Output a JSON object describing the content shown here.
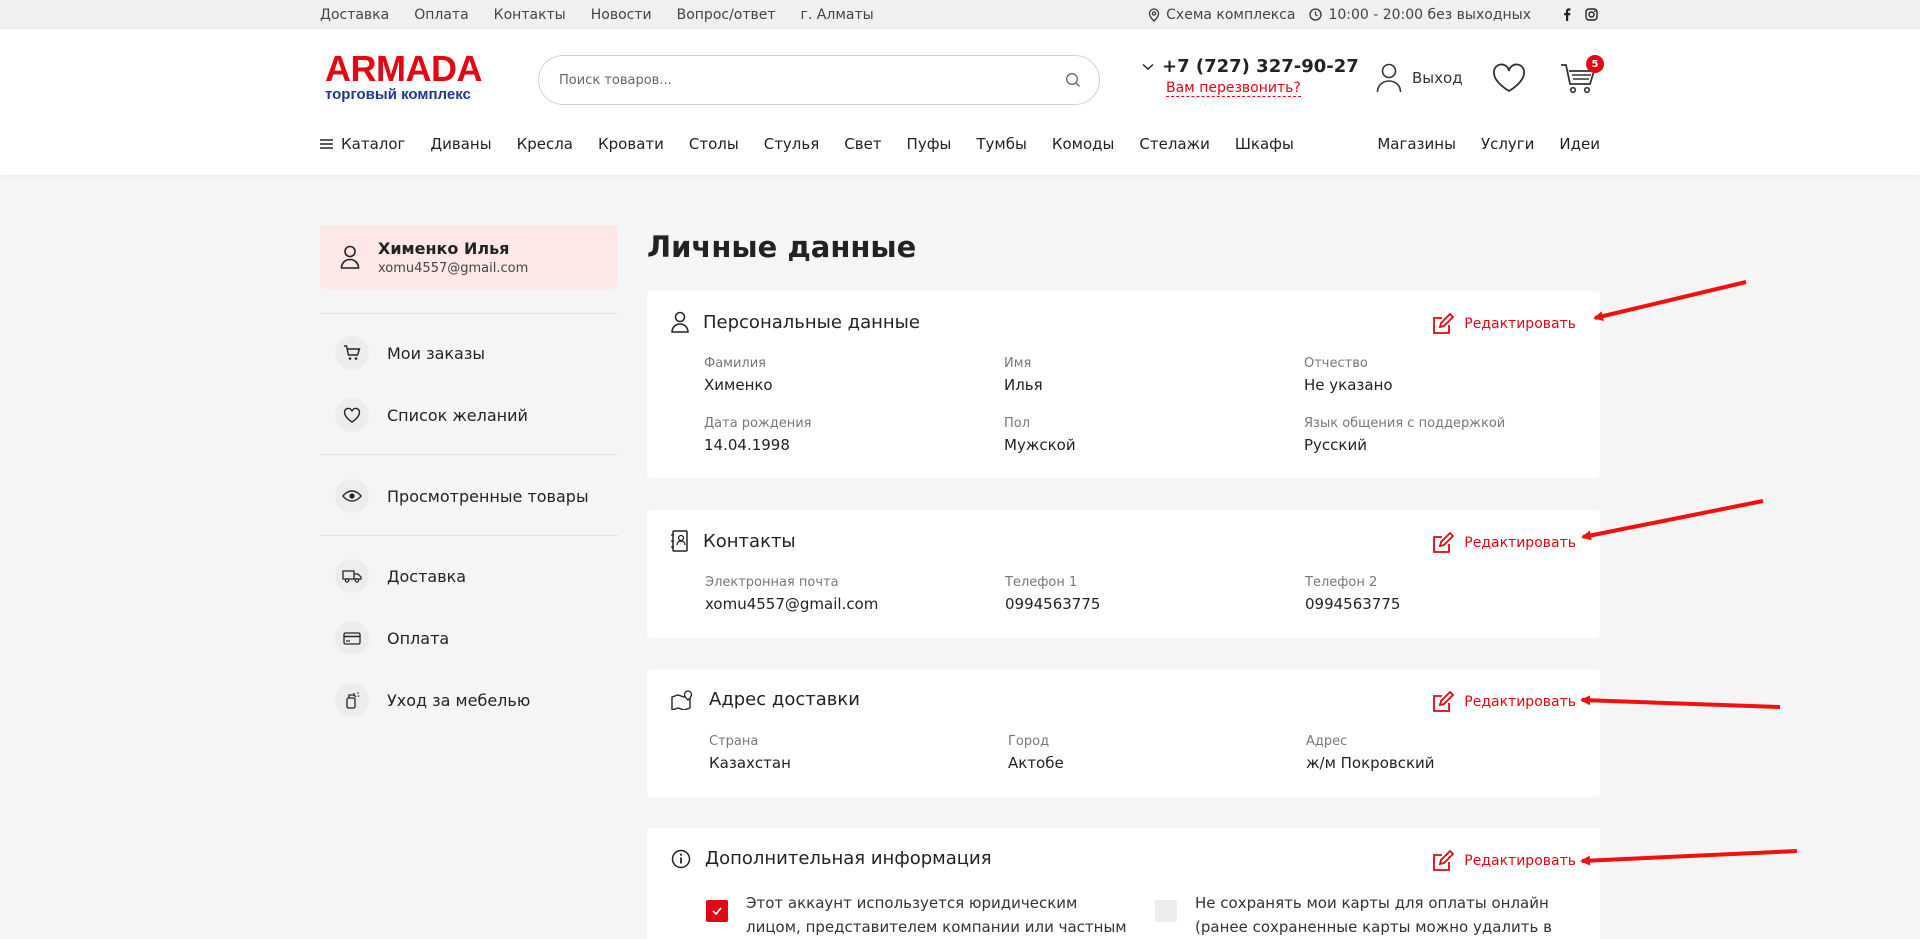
{
  "topbar": {
    "links": [
      "Доставка",
      "Оплата",
      "Контакты",
      "Новости",
      "Вопрос/ответ",
      "г. Алматы"
    ],
    "scheme": "Схема комплекса",
    "hours": "10:00 - 20:00 без выходных"
  },
  "header": {
    "logo_brand": "ARMADA",
    "logo_sub": "торговый комплекс",
    "search_placeholder": "Поиск товаров...",
    "phone": "+7 (727) 327-90-27",
    "callback": "Вам перезвонить?",
    "account_label": "Выход",
    "cart_count": "5"
  },
  "nav": {
    "catalog": "Каталог",
    "items": [
      "Диваны",
      "Кресла",
      "Кровати",
      "Столы",
      "Стулья",
      "Свет",
      "Пуфы",
      "Тумбы",
      "Комоды",
      "Стелажи",
      "Шкафы"
    ],
    "right": [
      "Магазины",
      "Услуги",
      "Идеи"
    ]
  },
  "sidebar": {
    "user_name": "Хименко Илья",
    "user_email": "xomu4557@gmail.com",
    "items": [
      "Мои заказы",
      "Список желаний",
      "Просмотренные товары",
      "Доставка",
      "Оплата",
      "Уход за мебелью"
    ]
  },
  "main": {
    "title": "Личные данные",
    "edit_label": "Редактировать",
    "personal": {
      "heading": "Персональные данные",
      "fields": [
        {
          "label": "Фамилия",
          "value": "Хименко"
        },
        {
          "label": "Имя",
          "value": "Илья"
        },
        {
          "label": "Отчество",
          "value": "Не указано"
        },
        {
          "label": "Дата рождения",
          "value": "14.04.1998"
        },
        {
          "label": "Пол",
          "value": "Мужской"
        },
        {
          "label": "Язык общения с поддержкой",
          "value": "Русский"
        }
      ]
    },
    "contacts": {
      "heading": "Контакты",
      "fields": [
        {
          "label": "Электронная почта",
          "value": "xomu4557@gmail.com"
        },
        {
          "label": "Телефон 1",
          "value": "0994563775"
        },
        {
          "label": "Телефон 2",
          "value": "0994563775"
        }
      ]
    },
    "address": {
      "heading": "Адрес доставки",
      "fields": [
        {
          "label": "Страна",
          "value": "Казахстан"
        },
        {
          "label": "Город",
          "value": "Актобе"
        },
        {
          "label": "Адрес",
          "value": "ж/м Покровский"
        }
      ]
    },
    "extra": {
      "heading": "Дополнительная информация",
      "option1": "Этот аккаунт используется юридическим лицом, представителем компании или частным",
      "option2": "Не сохранять мои карты для оплаты онлайн (ранее сохраненные карты можно удалить в"
    }
  },
  "colors": {
    "accent": "#e30613",
    "brand_blue": "#1e3a8a",
    "profile_bg": "#fde7e7",
    "page_bg": "#f5f5f5"
  }
}
